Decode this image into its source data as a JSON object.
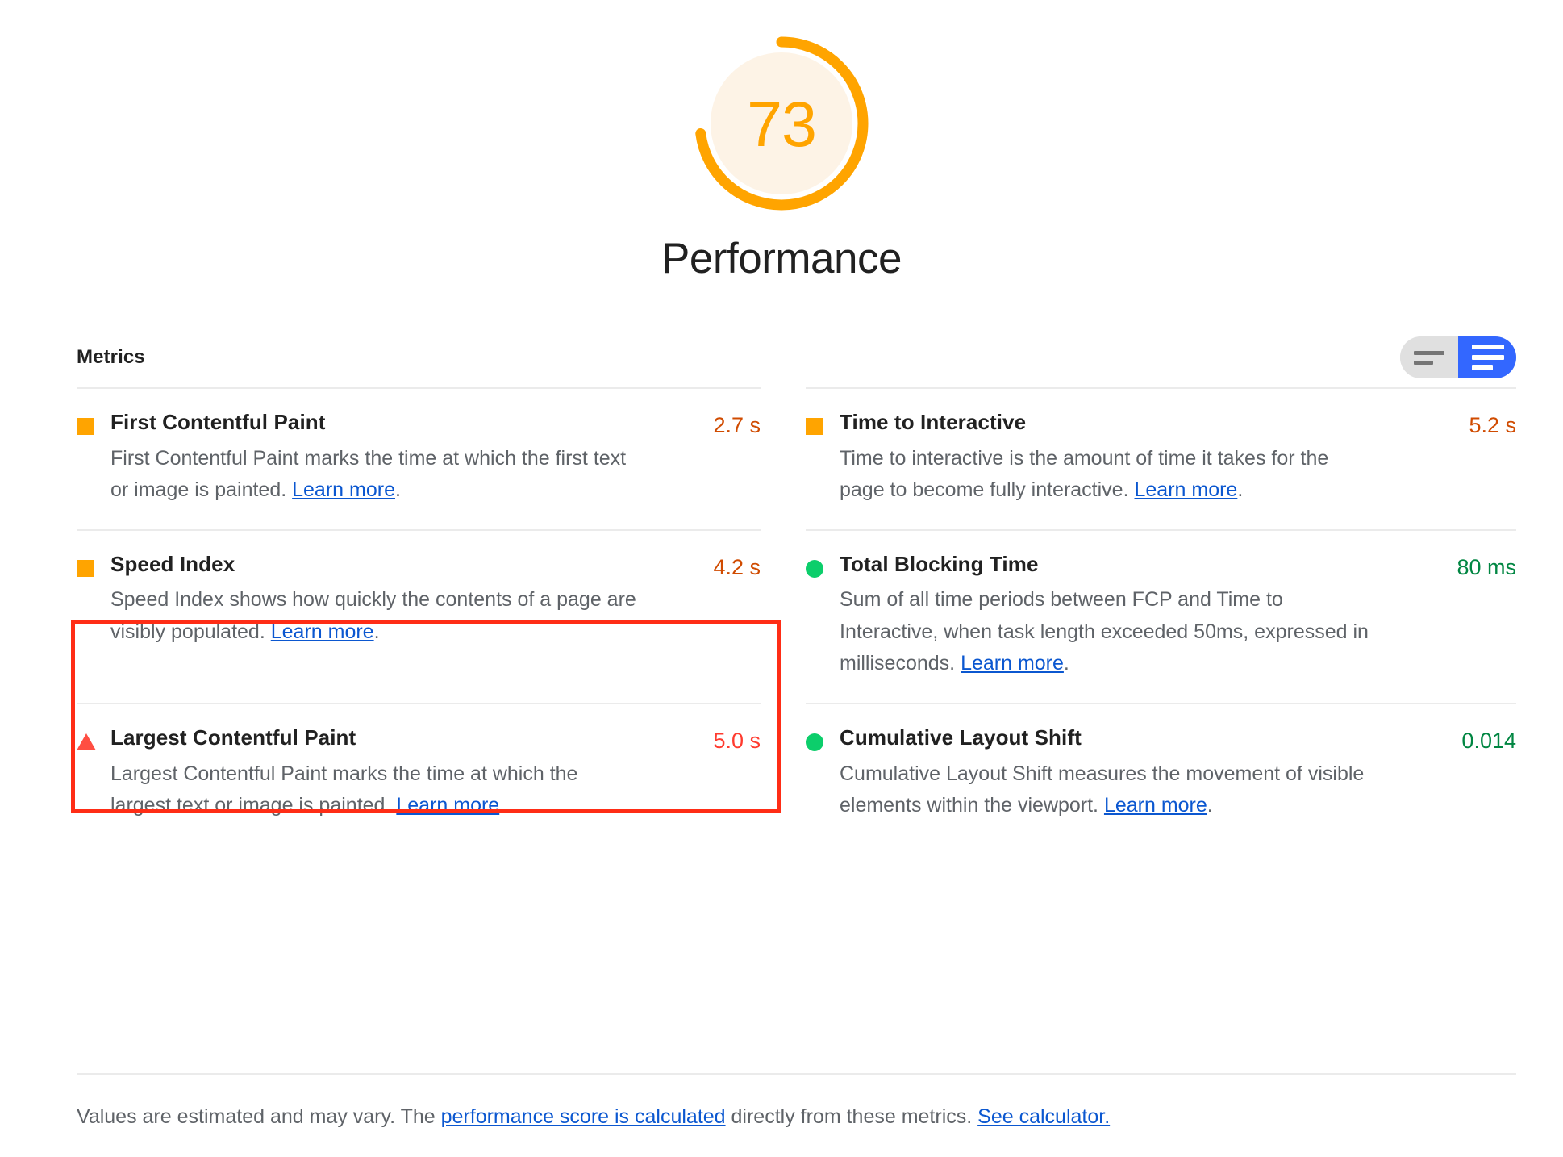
{
  "score": {
    "value": "73",
    "max": 100,
    "title": "Performance",
    "arc_color": "#FFA400",
    "track_color": "#FDF3E6"
  },
  "metrics_section": {
    "heading": "Metrics",
    "toggle": {
      "collapsed_label": "collapsed-view-toggle",
      "expanded_label": "expanded-view-toggle",
      "selected": "expanded",
      "active_color": "#3367ff",
      "inactive_color": "#e0e0e0"
    }
  },
  "metrics": [
    {
      "name": "First Contentful Paint",
      "icon": "square-icon",
      "icon_color": "#FFA400",
      "value": "2.7 s",
      "value_class": "v-orange",
      "desc_before": "First Contentful Paint marks the time at which the first text or image is painted. ",
      "link": "Learn more",
      "desc_after": "."
    },
    {
      "name": "Time to Interactive",
      "icon": "square-icon",
      "icon_color": "#FFA400",
      "value": "5.2 s",
      "value_class": "v-orange",
      "desc_before": "Time to interactive is the amount of time it takes for the page to become fully interactive. ",
      "link": "Learn more",
      "desc_after": "."
    },
    {
      "name": "Speed Index",
      "icon": "square-icon",
      "icon_color": "#FFA400",
      "value": "4.2 s",
      "value_class": "v-orange",
      "desc_before": "Speed Index shows how quickly the contents of a page are visibly populated. ",
      "link": "Learn more",
      "desc_after": ".",
      "highlighted": true
    },
    {
      "name": "Total Blocking Time",
      "icon": "circle-icon",
      "icon_color": "#0CCE6B",
      "value": "80 ms",
      "value_class": "v-green",
      "desc_before": "Sum of all time periods between FCP and Time to Interactive, when task length exceeded 50ms, expressed in milliseconds. ",
      "link": "Learn more",
      "desc_after": "."
    },
    {
      "name": "Largest Contentful Paint",
      "icon": "triangle-icon",
      "icon_color": "#FF4E42",
      "value": "5.0 s",
      "value_class": "v-red",
      "desc_before": "Largest Contentful Paint marks the time at which the largest text or image is painted. ",
      "link": "Learn more",
      "desc_after": ""
    },
    {
      "name": "Cumulative Layout Shift",
      "icon": "circle-icon",
      "icon_color": "#0CCE6B",
      "value": "0.014",
      "value_class": "v-green",
      "desc_before": "Cumulative Layout Shift measures the movement of visible elements within the viewport. ",
      "link": "Learn more",
      "desc_after": "."
    }
  ],
  "footer": {
    "part1": "Values are estimated and may vary. The ",
    "link1": "performance score is calculated",
    "part2": " directly from these metrics. ",
    "link2": "See calculator."
  }
}
